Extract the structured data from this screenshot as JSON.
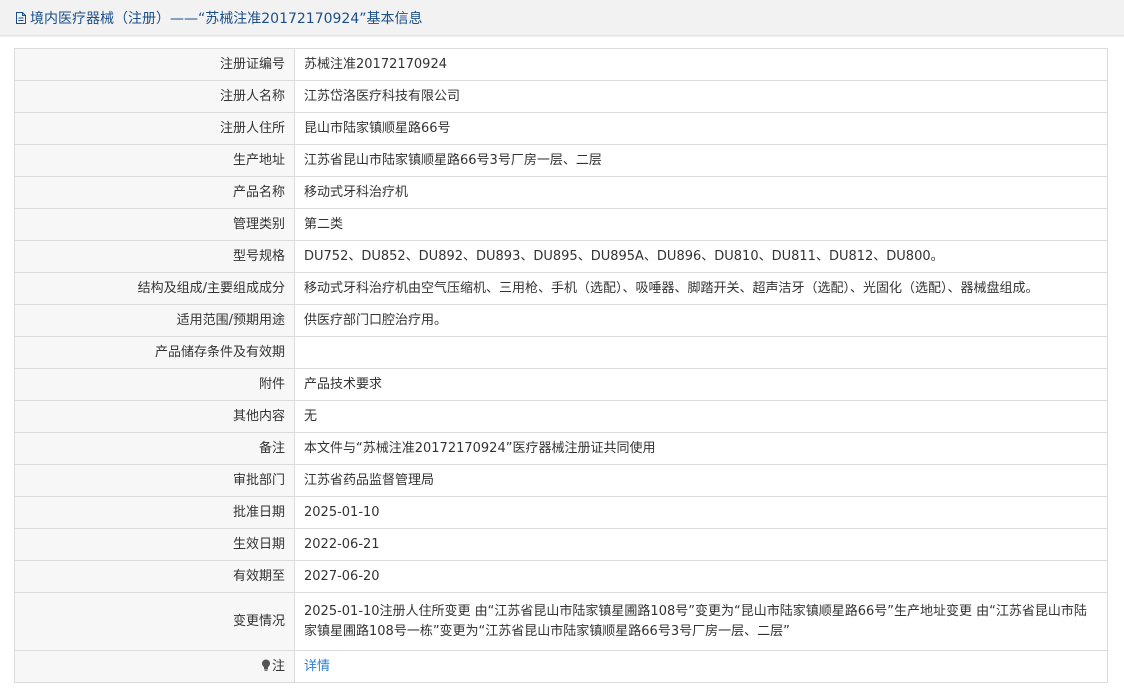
{
  "header": {
    "title": "境内医疗器械（注册）——“苏械注准20172170924”基本信息",
    "icon": "document-icon"
  },
  "rows": [
    {
      "label": "注册证编号",
      "value": "苏械注准20172170924"
    },
    {
      "label": "注册人名称",
      "value": "江苏岱洛医疗科技有限公司"
    },
    {
      "label": "注册人住所",
      "value": "昆山市陆家镇顺星路66号"
    },
    {
      "label": "生产地址",
      "value": "江苏省昆山市陆家镇顺星路66号3号厂房一层、二层"
    },
    {
      "label": "产品名称",
      "value": "移动式牙科治疗机"
    },
    {
      "label": "管理类别",
      "value": "第二类"
    },
    {
      "label": "型号规格",
      "value": "DU752、DU852、DU892、DU893、DU895、DU895A、DU896、DU810、DU811、DU812、DU800。"
    },
    {
      "label": "结构及组成/主要组成成分",
      "value": "移动式牙科治疗机由空气压缩机、三用枪、手机（选配）、吸唾器、脚踏开关、超声洁牙（选配）、光固化（选配）、器械盘组成。"
    },
    {
      "label": "适用范围/预期用途",
      "value": "供医疗部门口腔治疗用。"
    },
    {
      "label": "产品储存条件及有效期",
      "value": ""
    },
    {
      "label": "附件",
      "value": "产品技术要求"
    },
    {
      "label": "其他内容",
      "value": "无"
    },
    {
      "label": "备注",
      "value": "本文件与“苏械注准20172170924”医疗器械注册证共同使用"
    },
    {
      "label": "审批部门",
      "value": "江苏省药品监督管理局"
    },
    {
      "label": "批准日期",
      "value": "2025-01-10"
    },
    {
      "label": "生效日期",
      "value": "2022-06-21"
    },
    {
      "label": "有效期至",
      "value": "2027-06-20"
    },
    {
      "label": "变更情况",
      "value": "2025-01-10注册人住所变更 由“江苏省昆山市陆家镇星圃路108号”变更为“昆山市陆家镇顺星路66号”生产地址变更 由“江苏省昆山市陆家镇星圃路108号一栋”变更为“江苏省昆山市陆家镇顺星路66号3号厂房一层、二层”"
    }
  ],
  "note": {
    "label": "注",
    "icon": "lightbulb-icon",
    "link_text": "详情"
  },
  "colors": {
    "title": "#1a4f8b",
    "link": "#2a7fd4",
    "label_bg": "#f7f7f7",
    "border": "#dcdcdc"
  }
}
